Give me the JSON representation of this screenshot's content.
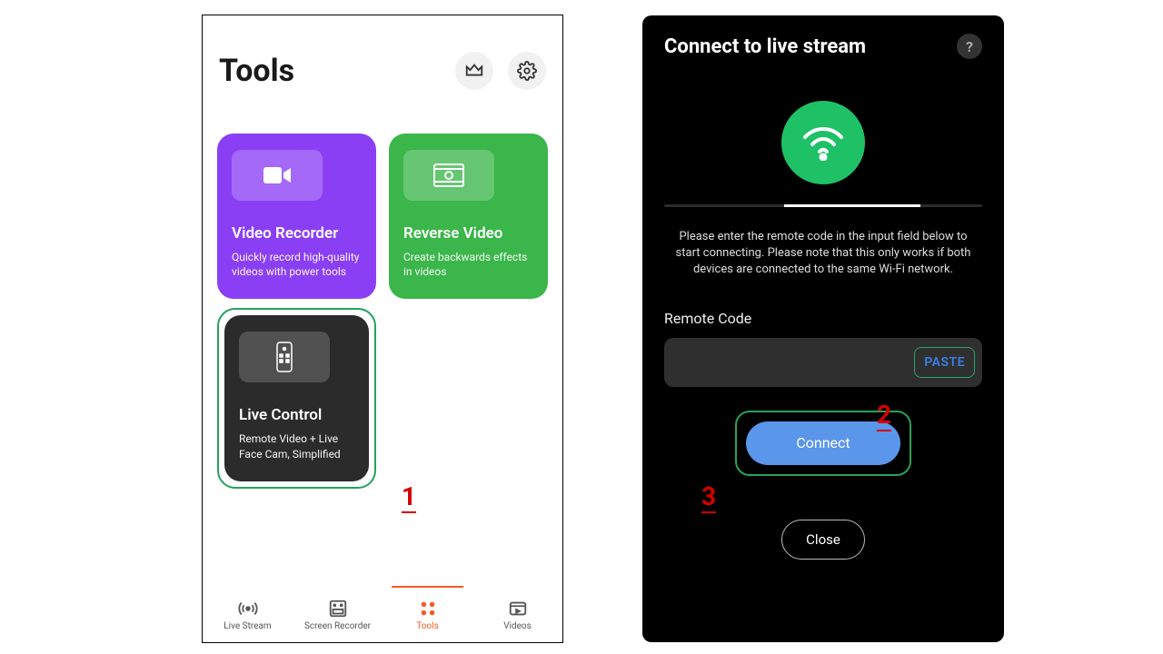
{
  "left": {
    "title": "Tools",
    "cards": [
      {
        "title": "Video Recorder",
        "desc": "Quickly record high-quality videos with power tools"
      },
      {
        "title": "Reverse Video",
        "desc": "Create backwards effects in videos"
      },
      {
        "title": "Live Control",
        "desc": "Remote Video + Live Face Cam, Simplified"
      }
    ],
    "nav": {
      "live": "Live Stream",
      "recorder": "Screen Recorder",
      "tools": "Tools",
      "videos": "Videos"
    }
  },
  "right": {
    "title": "Connect to live stream",
    "instructions": "Please enter the remote code in the input field below to start connecting. Please note that this only works if both devices are connected to the same Wi-Fi network.",
    "code_label": "Remote Code",
    "paste": "PASTE",
    "connect": "Connect",
    "close": "Close"
  },
  "annot": {
    "a1": "1",
    "a2": "2",
    "a3": "3"
  }
}
